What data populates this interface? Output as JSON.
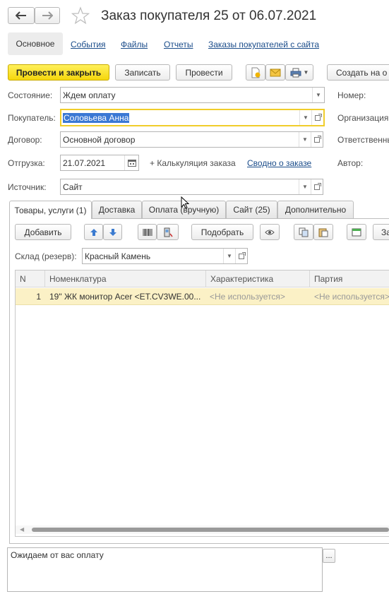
{
  "window": {
    "title": "Заказ покупателя 25 от 06.07.2021"
  },
  "nav": {
    "tabs": [
      {
        "label": "Основное"
      },
      {
        "label": "События"
      },
      {
        "label": "Файлы"
      },
      {
        "label": "Отчеты"
      },
      {
        "label": "Заказы покупателей с сайта"
      }
    ]
  },
  "toolbar": {
    "post_close": "Провести и закрыть",
    "save": "Записать",
    "post": "Провести",
    "create_based": "Создать на о"
  },
  "form": {
    "state_label": "Состояние:",
    "state_value": "Ждем оплату",
    "buyer_label": "Покупатель:",
    "buyer_value": "Соловьева Анна",
    "contract_label": "Договор:",
    "contract_value": "Основной договор",
    "shipment_label": "Отгрузка:",
    "shipment_value": "21.07.2021",
    "calc_label": "+ Калькуляция заказа",
    "summary_link": "Сводно о заказе",
    "source_label": "Источник:",
    "source_value": "Сайт",
    "number_label": "Номер:",
    "org_label": "Организация",
    "responsible_label": "Ответственны",
    "author_label": "Автор:"
  },
  "tabs": [
    {
      "label": "Товары, услуги (1)"
    },
    {
      "label": "Доставка"
    },
    {
      "label": "Оплата (вручную)"
    },
    {
      "label": "Сайт (25)"
    },
    {
      "label": "Дополнительно"
    }
  ],
  "goods_toolbar": {
    "add": "Добавить",
    "pick": "Подобрать",
    "more": "За"
  },
  "warehouse": {
    "label": "Склад (резерв):",
    "value": "Красный Камень"
  },
  "table": {
    "columns": [
      "N",
      "Номенклатура",
      "Характеристика",
      "Партия"
    ],
    "rows": [
      {
        "n": "1",
        "item": "19\" ЖК монитор Acer <ET.CV3WE.00...",
        "characteristic": "<Не используется>",
        "batch": "<Не используется>"
      }
    ]
  },
  "comment": {
    "text": "Ожидаем от вас оплату",
    "more": "..."
  },
  "colors": {
    "accent_yellow": "#f5d60c",
    "link_blue": "#1a4c8a",
    "row_highlight": "#fbf1c6"
  }
}
